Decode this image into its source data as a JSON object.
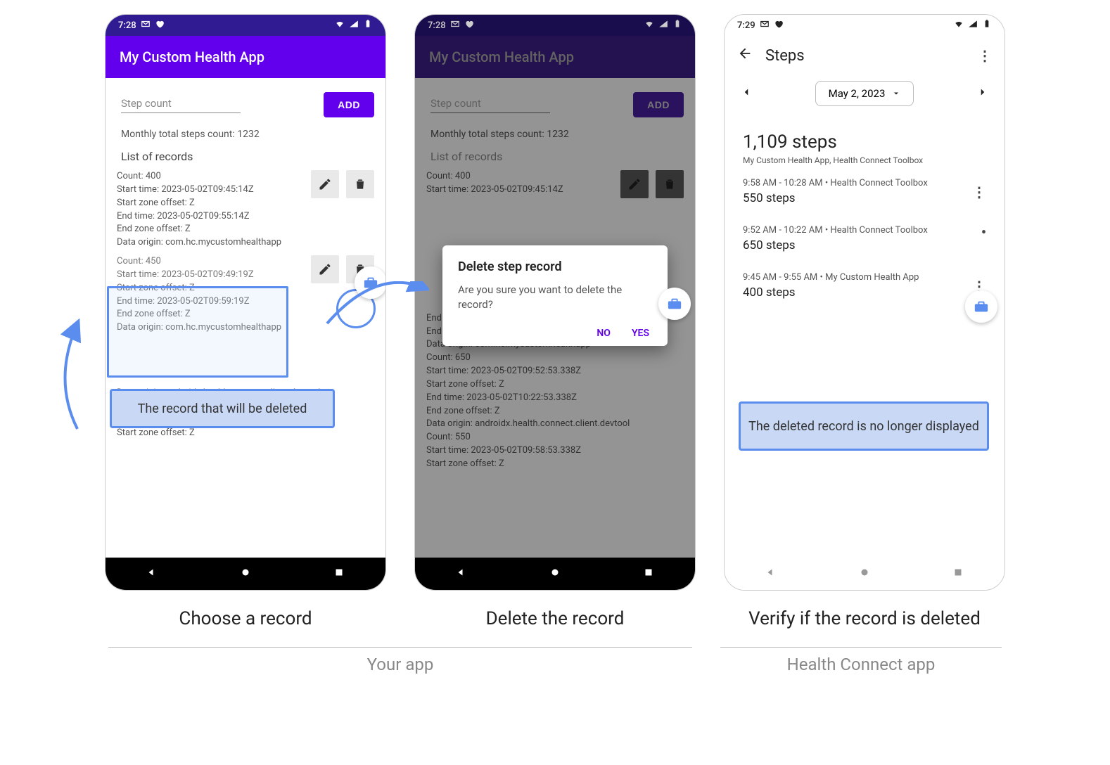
{
  "status": {
    "time1": "7:28",
    "time2": "7:28",
    "time3": "7:29"
  },
  "app_title": "My Custom Health App",
  "input_placeholder": "Step count",
  "add_button": "ADD",
  "monthly_label": "Monthly total steps count: 1232",
  "list_header": "List of records",
  "records_phone1": [
    {
      "count": "Count: 400",
      "start": "Start time: 2023-05-02T09:45:14Z",
      "szo": "Start zone offset: Z",
      "end": "End time: 2023-05-02T09:55:14Z",
      "ezo": "End zone offset: Z",
      "origin": "Data origin: com.hc.mycustomhealthapp"
    },
    {
      "count": "Count: 450",
      "start": "Start time: 2023-05-02T09:49:19Z",
      "szo": "Start zone offset: Z",
      "end": "End time: 2023-05-02T09:59:19Z",
      "ezo": "End zone offset: Z",
      "origin": "Data origin: com.hc.mycustomhealthapp"
    },
    {
      "origin_partial": "Data origin: androidx.health.connect.client.devtool",
      "count": "Count: 550",
      "start": "Start time: 2023-05-02T09:58:53.338Z",
      "szo": "Start zone offset: Z"
    }
  ],
  "records_phone2_overflow": [
    "End time: 2023-05-02T09:59:19Z",
    "End zone offset: Z",
    "Data origin: com.hc.mycustomhealthapp",
    "Count: 650",
    "Start time: 2023-05-02T09:52:53.338Z",
    "Start zone offset: Z",
    "End time: 2023-05-02T10:22:53.338Z",
    "End zone offset: Z",
    "Data origin: androidx.health.connect.client.devtool",
    "Count: 550",
    "Start time: 2023-05-02T09:58:53.338Z",
    "Start zone offset: Z"
  ],
  "dialog": {
    "title": "Delete step record",
    "body": "Are you sure you want to delete the record?",
    "no": "NO",
    "yes": "YES"
  },
  "annotation1": "The record that will be deleted",
  "annotation3": "The deleted record is no longer displayed",
  "hc": {
    "title": "Steps",
    "date": "May 2, 2023",
    "total": "1,109 steps",
    "sources": "My Custom Health App, Health Connect Toolbox",
    "entries": [
      {
        "meta": "9:58 AM - 10:28 AM • Health Connect Toolbox",
        "val": "550 steps"
      },
      {
        "meta": "9:52 AM - 10:22 AM • Health Connect Toolbox",
        "val": "650 steps"
      },
      {
        "meta": "9:45 AM - 9:55 AM • My Custom Health App",
        "val": "400 steps"
      }
    ]
  },
  "captions": {
    "c1": "Choose a record",
    "c2": "Delete the record",
    "c3": "Verify if the record is deleted"
  },
  "sections": {
    "left": "Your app",
    "right": "Health Connect app"
  }
}
